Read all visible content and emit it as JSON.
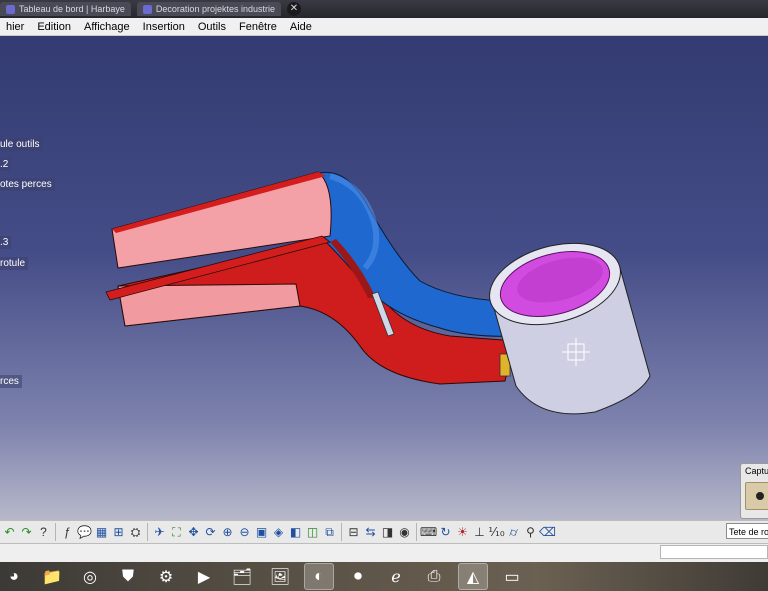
{
  "window_tabs": [
    {
      "label": "Tableau de bord | Harbaye"
    },
    {
      "label": "Decoration projektes industrie"
    }
  ],
  "window_close": "✕",
  "menu": [
    {
      "label": "hier"
    },
    {
      "label": "Edition"
    },
    {
      "label": "Affichage"
    },
    {
      "label": "Insertion"
    },
    {
      "label": "Outils"
    },
    {
      "label": "Fenêtre"
    },
    {
      "label": "Aide"
    }
  ],
  "tree": [
    {
      "label": "ule outils"
    },
    {
      "label": ".2"
    },
    {
      "label": "otes perces"
    },
    {
      "label": ".3"
    },
    {
      "label": "rotule"
    },
    {
      "label": "rces"
    }
  ],
  "capture_panel": {
    "title": "Captu"
  },
  "toolbar": {
    "icons": [
      "undo-icon",
      "redo-icon",
      "whats-this-icon",
      "formula-icon",
      "comment-icon",
      "table-icon",
      "hierarchy-icon",
      "catalog-icon",
      "fly-mode-icon",
      "fit-all-icon",
      "pan-icon",
      "rotate-icon",
      "zoom-in-icon",
      "zoom-out-icon",
      "normal-view-icon",
      "iso-view-icon",
      "shading-icon",
      "hide-show-icon",
      "swap-space-icon",
      "multi-view-icon",
      "analysis-icon",
      "measure-icon",
      "snapshot-icon",
      "update-icon",
      "axis-icon",
      "units-icon",
      "rendering-icon",
      "cylinder-icon",
      "eraser-icon"
    ],
    "command_value": "Tete de rotule"
  },
  "colors": {
    "part_pink": "#f5a3a8",
    "part_red": "#d41e1e",
    "part_blue": "#1f6fd6",
    "bore_magenta": "#d24be0",
    "cylinder_gray": "#cfcfe4"
  },
  "taskbar_apps": [
    "start-orb-icon",
    "file-explorer-icon",
    "media-player-icon",
    "security-icon",
    "settings-gear-icon",
    "video-icon",
    "folder-icon",
    "paint-icon",
    "chrome-icon",
    "recorder-icon",
    "ie-icon",
    "printer-icon",
    "catia-icon",
    "window-icon"
  ]
}
